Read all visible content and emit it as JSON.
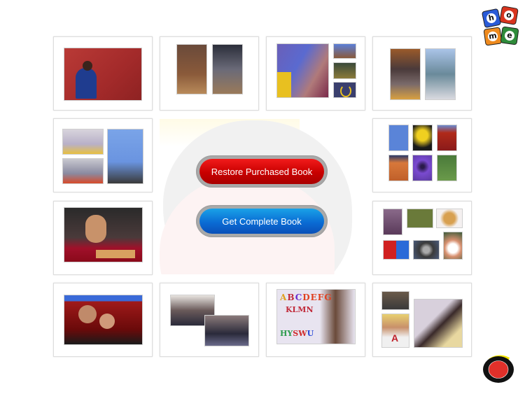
{
  "buttons": {
    "restore_label": "Restore Purchased Book",
    "get_complete_label": "Get Complete Book",
    "restore_color": "#d40000",
    "get_complete_color": "#0a74d8"
  },
  "home_icon": {
    "letters": [
      "h",
      "o",
      "m",
      "e"
    ],
    "colors": [
      "#2a5bd7",
      "#d8341e",
      "#ee8a1e",
      "#2e8b3a"
    ]
  },
  "record_icon": {
    "name": "record-button-icon",
    "fill": "#e0302a",
    "ring": "#111111",
    "accent": "#f5e600"
  },
  "thumbnails": [
    {
      "id": "page-1",
      "description": "child reaching for book"
    },
    {
      "id": "page-2",
      "description": "adult and child reading on floor"
    },
    {
      "id": "page-3",
      "description": "child with painting and signs"
    },
    {
      "id": "page-4",
      "description": "library reading and potty"
    },
    {
      "id": "page-5",
      "description": "children playing with blocks"
    },
    {
      "id": "page-6",
      "description": "six photo grid of objects"
    },
    {
      "id": "page-7",
      "description": "girl with stacking toy"
    },
    {
      "id": "page-8",
      "description": "objects collage"
    },
    {
      "id": "page-9",
      "description": "mother and child reading on couch"
    },
    {
      "id": "page-10",
      "description": "family reading on sofa"
    },
    {
      "id": "page-11",
      "description": "girl with alphabet magnets"
    },
    {
      "id": "page-12",
      "description": "letter A activities"
    }
  ]
}
